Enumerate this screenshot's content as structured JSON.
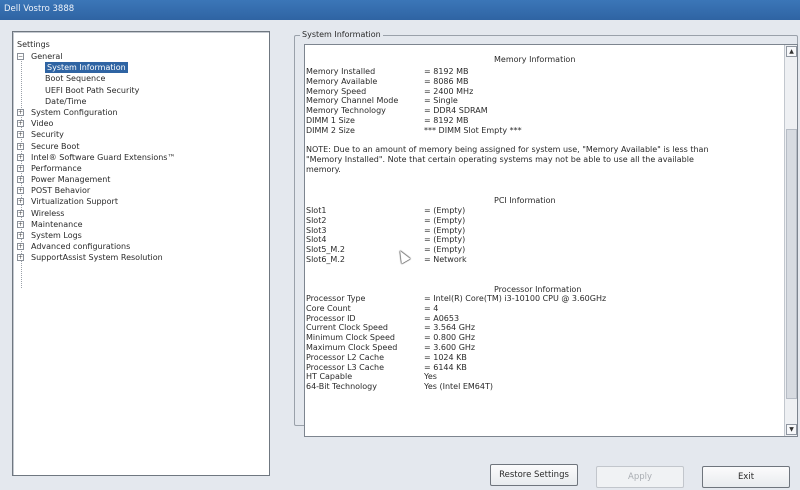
{
  "window": {
    "title": "Dell Vostro 3888"
  },
  "tree": {
    "root": "Settings",
    "items": [
      {
        "label": "General",
        "level": 0,
        "expanded": true
      },
      {
        "label": "System Information",
        "level": 1,
        "selected": true
      },
      {
        "label": "Boot Sequence",
        "level": 1
      },
      {
        "label": "UEFI Boot Path Security",
        "level": 1
      },
      {
        "label": "Date/Time",
        "level": 1
      },
      {
        "label": "System Configuration",
        "level": 0
      },
      {
        "label": "Video",
        "level": 0
      },
      {
        "label": "Security",
        "level": 0
      },
      {
        "label": "Secure Boot",
        "level": 0
      },
      {
        "label": "Intel® Software Guard Extensions™",
        "level": 0
      },
      {
        "label": "Performance",
        "level": 0
      },
      {
        "label": "Power Management",
        "level": 0
      },
      {
        "label": "POST Behavior",
        "level": 0
      },
      {
        "label": "Virtualization Support",
        "level": 0
      },
      {
        "label": "Wireless",
        "level": 0
      },
      {
        "label": "Maintenance",
        "level": 0
      },
      {
        "label": "System Logs",
        "level": 0
      },
      {
        "label": "Advanced configurations",
        "level": 0
      },
      {
        "label": "SupportAssist System Resolution",
        "level": 0
      }
    ]
  },
  "panel": {
    "legend": "System Information",
    "memory": {
      "title": "Memory Information",
      "rows": [
        {
          "k": "Memory Installed",
          "v": "= 8192 MB"
        },
        {
          "k": "Memory Available",
          "v": "= 8086 MB"
        },
        {
          "k": "Memory Speed",
          "v": "= 2400 MHz"
        },
        {
          "k": "Memory Channel Mode",
          "v": "= Single"
        },
        {
          "k": "Memory Technology",
          "v": "= DDR4 SDRAM"
        },
        {
          "k": "DIMM 1 Size",
          "v": "= 8192 MB"
        },
        {
          "k": "DIMM 2 Size",
          "v": "*** DIMM Slot Empty ***"
        }
      ],
      "note": "NOTE: Due to an amount of memory being assigned for system use, \"Memory Available\" is less than \"Memory Installed\". Note that certain operating systems may not be able to use all the available memory."
    },
    "pci": {
      "title": "PCI Information",
      "rows": [
        {
          "k": "Slot1",
          "v": "= (Empty)"
        },
        {
          "k": "Slot2",
          "v": "= (Empty)"
        },
        {
          "k": "Slot3",
          "v": "= (Empty)"
        },
        {
          "k": "Slot4",
          "v": "= (Empty)"
        },
        {
          "k": "Slot5_M.2",
          "v": "= (Empty)"
        },
        {
          "k": "Slot6_M.2",
          "v": "= Network"
        }
      ]
    },
    "processor": {
      "title": "Processor Information",
      "rows": [
        {
          "k": "Processor Type",
          "v": "= Intel(R) Core(TM) i3-10100 CPU @ 3.60GHz"
        },
        {
          "k": "Core Count",
          "v": "= 4"
        },
        {
          "k": "Processor ID",
          "v": "= A0653"
        },
        {
          "k": "Current Clock Speed",
          "v": "= 3.564 GHz"
        },
        {
          "k": "Minimum Clock Speed",
          "v": "= 0.800 GHz"
        },
        {
          "k": "Maximum Clock Speed",
          "v": "= 3.600 GHz"
        },
        {
          "k": "Processor L2 Cache",
          "v": "= 1024 KB"
        },
        {
          "k": "Processor L3 Cache",
          "v": "= 6144 KB"
        },
        {
          "k": "HT Capable",
          "v": "Yes"
        },
        {
          "k": "64-Bit Technology",
          "v": "Yes (Intel EM64T)"
        }
      ]
    }
  },
  "buttons": {
    "restore": "Restore Settings",
    "apply": "Apply",
    "exit": "Exit"
  }
}
